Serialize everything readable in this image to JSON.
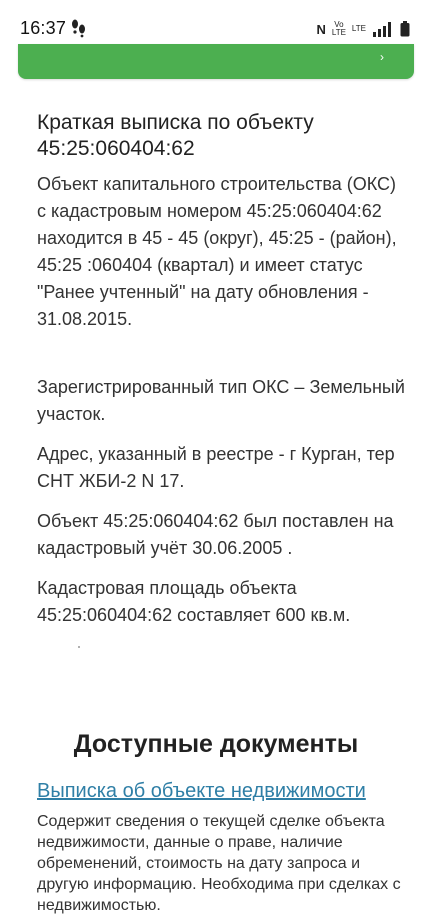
{
  "status_bar": {
    "time": "16:37",
    "nfc": "N",
    "volte": "Vo\nLTE",
    "lte": "LTE"
  },
  "summary": {
    "title": "Краткая выписка по объекту 45:25:060404:62",
    "paragraphs": [
      "Объект капитального строительства (ОКС) с кадастровым номером 45:25:060404:62 находится в 45 - 45 (округ), 45:25 - (район), 45:25 :060404 (квартал) и имеет статус \"Ранее учтенный\" на дату обновления - 31.08.2015.",
      "Зарегистрированный тип ОКС – Земельный участок.",
      "Адрес, указанный в реестре - г Курган, тер СНТ ЖБИ-2 N 17.",
      "Объект 45:25:060404:62 был поставлен на кадастровый учёт 30.06.2005 .",
      "Кадастровая площадь объекта 45:25:060404:62 составляет 600 кв.м."
    ]
  },
  "documents": {
    "section_title": "Доступные документы",
    "link_label": "Выписка об объекте недвижимости",
    "description": "Содержит сведения о текущей сделке объекта недвижимости, данные о праве, наличие обременений, стоимость на дату запроса и другую информацию. Необходима при сделках с недвижимостью."
  },
  "colors": {
    "accent_green": "#4caf50",
    "link": "#2f7fa6"
  }
}
